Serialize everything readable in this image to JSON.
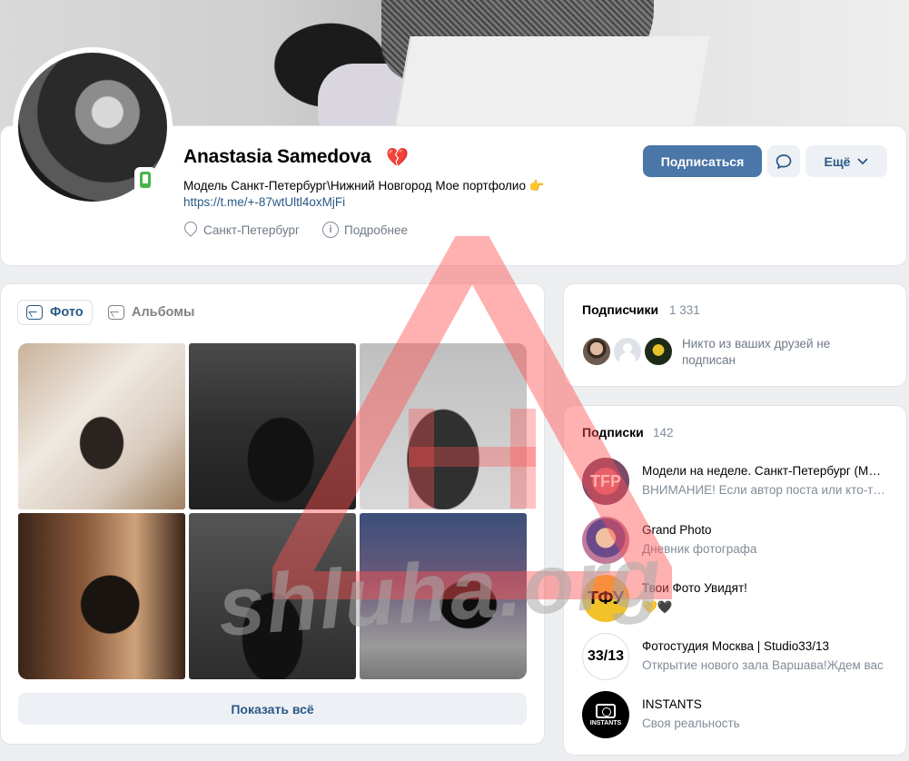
{
  "profile": {
    "name": "Anastasia Samedova",
    "name_emoji": "💔",
    "status": "Модель Санкт-Петербург\\Нижний Новгород Мое портфолио 👉",
    "status_link": "https://t.me/+-87wtUltl4oxMjFi",
    "location": "Санкт-Петербург",
    "more_info": "Подробнее"
  },
  "actions": {
    "subscribe": "Подписаться",
    "more": "Ещё"
  },
  "photos": {
    "tab_photos": "Фото",
    "tab_albums": "Альбомы",
    "show_all": "Показать всё"
  },
  "followers": {
    "title": "Подписчики",
    "count": "1 331",
    "no_friends": "Никто из ваших друзей не подписан"
  },
  "subscriptions": {
    "title": "Подписки",
    "count": "142",
    "items": [
      {
        "name": "Модели на неделе. Санкт-Петербург (Модели СПБ)",
        "desc": "ВНИМАНИЕ! Если автор поста или кто-то из отмеченных",
        "avatar_text": "TFP"
      },
      {
        "name": "Grand Photo",
        "desc": "Дневник фотографа",
        "avatar_text": ""
      },
      {
        "name": "Твои Фото Увидят!",
        "desc": "💛🖤",
        "avatar_text": "ТФУ"
      },
      {
        "name": "Фотостудия Москва | Studio33/13",
        "desc": "Открытие нового зала Варшава!Ждем вас",
        "avatar_text": "33/13"
      },
      {
        "name": "INSTANTS",
        "desc": "Своя реальность",
        "avatar_text": "INSTANTS"
      }
    ]
  },
  "watermark": {
    "text": "shluha.org"
  },
  "colors": {
    "accent": "#4a76a8",
    "link": "#2a5885",
    "online": "#4bb34b",
    "watermark": "#ff4a4a"
  }
}
